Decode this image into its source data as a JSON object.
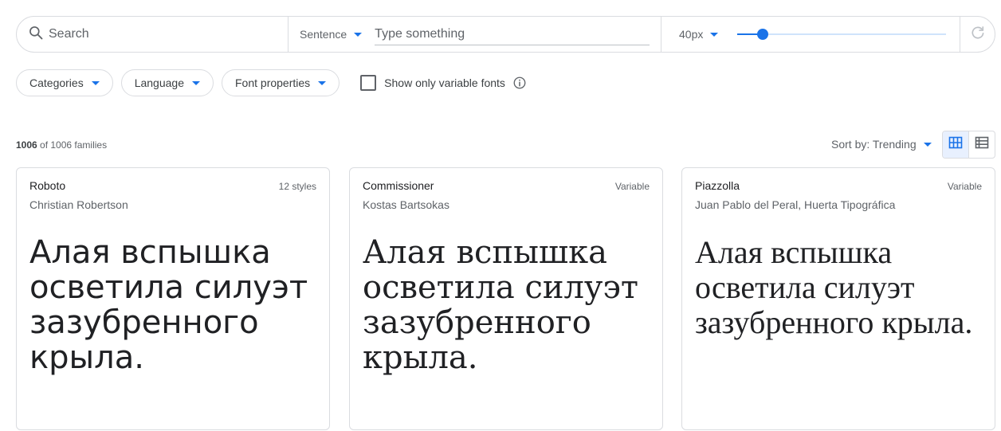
{
  "colors": {
    "accent": "#1a73e8",
    "border": "#dadce0",
    "muted": "#5f6368"
  },
  "search": {
    "placeholder": "Search",
    "icon": "search-icon"
  },
  "preview": {
    "mode_label": "Sentence",
    "text_placeholder": "Type something",
    "size_label": "40px",
    "size_slider_fraction": 0.12,
    "reset_icon": "refresh-icon"
  },
  "filters": {
    "categories": "Categories",
    "language": "Language",
    "font_properties": "Font properties",
    "variable_only_label": "Show only variable fonts",
    "variable_only_checked": false,
    "info_icon": "info-icon"
  },
  "results": {
    "count_shown": "1006",
    "count_text": " of 1006 families",
    "sort_label": "Sort by: Trending",
    "view_icons": [
      "grid-view-icon",
      "list-view-icon"
    ]
  },
  "cards": [
    {
      "name": "Roboto",
      "meta": "12 styles",
      "author": "Christian Robertson",
      "preview": "Алая вспышка осветила силуэт зазубренного крыла."
    },
    {
      "name": "Commissioner",
      "meta": "Variable",
      "author": "Kostas Bartsokas",
      "preview": "Алая вспышка осветила силуэт зазубренного крыла."
    },
    {
      "name": "Piazzolla",
      "meta": "Variable",
      "author": "Juan Pablo del Peral, Huerta Tipográfica",
      "preview": "Алая вспышка осветила силуэт зазубренного крыла."
    }
  ]
}
